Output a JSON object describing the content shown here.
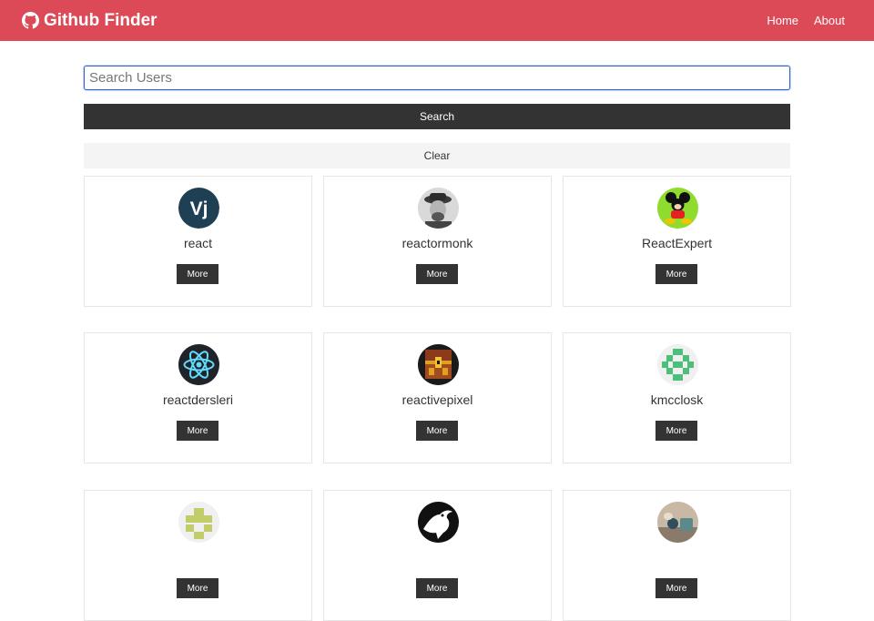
{
  "navbar": {
    "brand_icon": "github-icon",
    "title": "Github Finder",
    "links": [
      "Home",
      "About"
    ],
    "background": "#dc4a57"
  },
  "search": {
    "placeholder": "Search Users",
    "value": "",
    "search_label": "Search",
    "clear_label": "Clear"
  },
  "users": [
    {
      "login": "react",
      "button": "More",
      "avatar": "vj-logo-avatar"
    },
    {
      "login": "reactormonk",
      "button": "More",
      "avatar": "man-with-hat-photo-avatar"
    },
    {
      "login": "ReactExpert",
      "button": "More",
      "avatar": "mickey-mouse-avatar"
    },
    {
      "login": "reactdersleri",
      "button": "More",
      "avatar": "react-atom-logo-avatar"
    },
    {
      "login": "reactivepixel",
      "button": "More",
      "avatar": "pixel-treasure-chest-avatar"
    },
    {
      "login": "kmcclosk",
      "button": "More",
      "avatar": "green-identicon-avatar"
    },
    {
      "login": "",
      "button": "More",
      "avatar": "olive-identicon-avatar"
    },
    {
      "login": "",
      "button": "More",
      "avatar": "black-bird-silhouette-avatar"
    },
    {
      "login": "",
      "button": "More",
      "avatar": "photo-avatar"
    }
  ]
}
